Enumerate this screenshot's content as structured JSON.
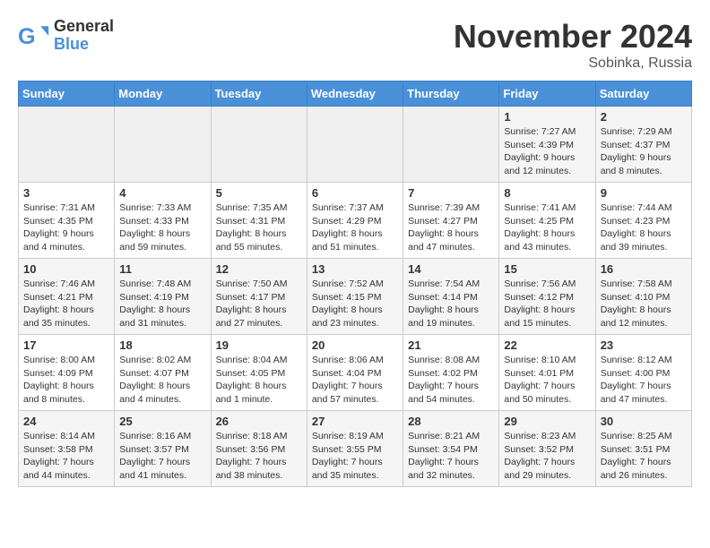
{
  "header": {
    "logo_general": "General",
    "logo_blue": "Blue",
    "month_title": "November 2024",
    "location": "Sobinka, Russia"
  },
  "weekdays": [
    "Sunday",
    "Monday",
    "Tuesday",
    "Wednesday",
    "Thursday",
    "Friday",
    "Saturday"
  ],
  "weeks": [
    [
      {
        "day": "",
        "info": ""
      },
      {
        "day": "",
        "info": ""
      },
      {
        "day": "",
        "info": ""
      },
      {
        "day": "",
        "info": ""
      },
      {
        "day": "",
        "info": ""
      },
      {
        "day": "1",
        "info": "Sunrise: 7:27 AM\nSunset: 4:39 PM\nDaylight: 9 hours and 12 minutes."
      },
      {
        "day": "2",
        "info": "Sunrise: 7:29 AM\nSunset: 4:37 PM\nDaylight: 9 hours and 8 minutes."
      }
    ],
    [
      {
        "day": "3",
        "info": "Sunrise: 7:31 AM\nSunset: 4:35 PM\nDaylight: 9 hours and 4 minutes."
      },
      {
        "day": "4",
        "info": "Sunrise: 7:33 AM\nSunset: 4:33 PM\nDaylight: 8 hours and 59 minutes."
      },
      {
        "day": "5",
        "info": "Sunrise: 7:35 AM\nSunset: 4:31 PM\nDaylight: 8 hours and 55 minutes."
      },
      {
        "day": "6",
        "info": "Sunrise: 7:37 AM\nSunset: 4:29 PM\nDaylight: 8 hours and 51 minutes."
      },
      {
        "day": "7",
        "info": "Sunrise: 7:39 AM\nSunset: 4:27 PM\nDaylight: 8 hours and 47 minutes."
      },
      {
        "day": "8",
        "info": "Sunrise: 7:41 AM\nSunset: 4:25 PM\nDaylight: 8 hours and 43 minutes."
      },
      {
        "day": "9",
        "info": "Sunrise: 7:44 AM\nSunset: 4:23 PM\nDaylight: 8 hours and 39 minutes."
      }
    ],
    [
      {
        "day": "10",
        "info": "Sunrise: 7:46 AM\nSunset: 4:21 PM\nDaylight: 8 hours and 35 minutes."
      },
      {
        "day": "11",
        "info": "Sunrise: 7:48 AM\nSunset: 4:19 PM\nDaylight: 8 hours and 31 minutes."
      },
      {
        "day": "12",
        "info": "Sunrise: 7:50 AM\nSunset: 4:17 PM\nDaylight: 8 hours and 27 minutes."
      },
      {
        "day": "13",
        "info": "Sunrise: 7:52 AM\nSunset: 4:15 PM\nDaylight: 8 hours and 23 minutes."
      },
      {
        "day": "14",
        "info": "Sunrise: 7:54 AM\nSunset: 4:14 PM\nDaylight: 8 hours and 19 minutes."
      },
      {
        "day": "15",
        "info": "Sunrise: 7:56 AM\nSunset: 4:12 PM\nDaylight: 8 hours and 15 minutes."
      },
      {
        "day": "16",
        "info": "Sunrise: 7:58 AM\nSunset: 4:10 PM\nDaylight: 8 hours and 12 minutes."
      }
    ],
    [
      {
        "day": "17",
        "info": "Sunrise: 8:00 AM\nSunset: 4:09 PM\nDaylight: 8 hours and 8 minutes."
      },
      {
        "day": "18",
        "info": "Sunrise: 8:02 AM\nSunset: 4:07 PM\nDaylight: 8 hours and 4 minutes."
      },
      {
        "day": "19",
        "info": "Sunrise: 8:04 AM\nSunset: 4:05 PM\nDaylight: 8 hours and 1 minute."
      },
      {
        "day": "20",
        "info": "Sunrise: 8:06 AM\nSunset: 4:04 PM\nDaylight: 7 hours and 57 minutes."
      },
      {
        "day": "21",
        "info": "Sunrise: 8:08 AM\nSunset: 4:02 PM\nDaylight: 7 hours and 54 minutes."
      },
      {
        "day": "22",
        "info": "Sunrise: 8:10 AM\nSunset: 4:01 PM\nDaylight: 7 hours and 50 minutes."
      },
      {
        "day": "23",
        "info": "Sunrise: 8:12 AM\nSunset: 4:00 PM\nDaylight: 7 hours and 47 minutes."
      }
    ],
    [
      {
        "day": "24",
        "info": "Sunrise: 8:14 AM\nSunset: 3:58 PM\nDaylight: 7 hours and 44 minutes."
      },
      {
        "day": "25",
        "info": "Sunrise: 8:16 AM\nSunset: 3:57 PM\nDaylight: 7 hours and 41 minutes."
      },
      {
        "day": "26",
        "info": "Sunrise: 8:18 AM\nSunset: 3:56 PM\nDaylight: 7 hours and 38 minutes."
      },
      {
        "day": "27",
        "info": "Sunrise: 8:19 AM\nSunset: 3:55 PM\nDaylight: 7 hours and 35 minutes."
      },
      {
        "day": "28",
        "info": "Sunrise: 8:21 AM\nSunset: 3:54 PM\nDaylight: 7 hours and 32 minutes."
      },
      {
        "day": "29",
        "info": "Sunrise: 8:23 AM\nSunset: 3:52 PM\nDaylight: 7 hours and 29 minutes."
      },
      {
        "day": "30",
        "info": "Sunrise: 8:25 AM\nSunset: 3:51 PM\nDaylight: 7 hours and 26 minutes."
      }
    ]
  ]
}
